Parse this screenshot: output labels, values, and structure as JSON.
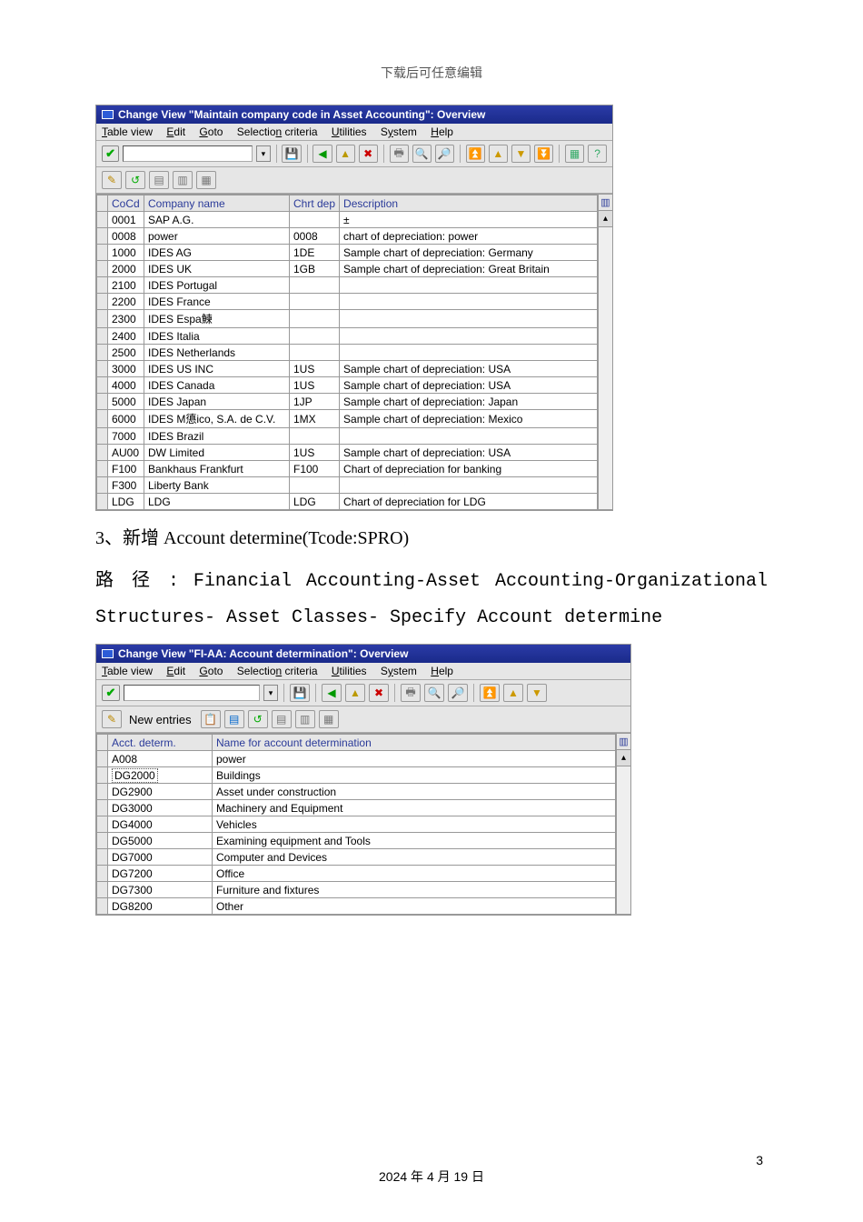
{
  "page_header": "下载后可任意编辑",
  "page_footer_date": "2024 年 4 月 19 日",
  "page_number": "3",
  "window1": {
    "title": "Change View \"Maintain company code in Asset Accounting\": Overview",
    "menu": [
      "Table view",
      "Edit",
      "Goto",
      "Selection criteria",
      "Utilities",
      "System",
      "Help"
    ],
    "columns": {
      "cocd": "CoCd",
      "cname": "Company name",
      "chrt": "Chrt dep",
      "desc": "Description"
    },
    "rows": [
      {
        "cocd": "0001",
        "cname": "SAP A.G.",
        "chrt": "",
        "desc": "",
        "extra": "±"
      },
      {
        "cocd": "0008",
        "cname": "power",
        "chrt": "0008",
        "desc": "chart of depreciation: power"
      },
      {
        "cocd": "1000",
        "cname": "IDES AG",
        "chrt": "1DE",
        "desc": "Sample chart of depreciation: Germany"
      },
      {
        "cocd": "2000",
        "cname": "IDES UK",
        "chrt": "1GB",
        "desc": "Sample chart of depreciation: Great Britain"
      },
      {
        "cocd": "2100",
        "cname": "IDES Portugal",
        "chrt": "",
        "desc": ""
      },
      {
        "cocd": "2200",
        "cname": "IDES France",
        "chrt": "",
        "desc": ""
      },
      {
        "cocd": "2300",
        "cname": "IDES Espa鰊",
        "chrt": "",
        "desc": ""
      },
      {
        "cocd": "2400",
        "cname": "IDES Italia",
        "chrt": "",
        "desc": ""
      },
      {
        "cocd": "2500",
        "cname": "IDES Netherlands",
        "chrt": "",
        "desc": ""
      },
      {
        "cocd": "3000",
        "cname": "IDES US INC",
        "chrt": "1US",
        "desc": "Sample chart of depreciation: USA"
      },
      {
        "cocd": "4000",
        "cname": "IDES Canada",
        "chrt": "1US",
        "desc": "Sample chart of depreciation: USA"
      },
      {
        "cocd": "5000",
        "cname": "IDES Japan",
        "chrt": "1JP",
        "desc": "Sample chart of depreciation: Japan"
      },
      {
        "cocd": "6000",
        "cname": "IDES M憄ico, S.A. de C.V.",
        "chrt": "1MX",
        "desc": "Sample chart of depreciation: Mexico"
      },
      {
        "cocd": "7000",
        "cname": "IDES Brazil",
        "chrt": "",
        "desc": ""
      },
      {
        "cocd": "AU00",
        "cname": "DW Limited",
        "chrt": "1US",
        "desc": "Sample chart of depreciation: USA"
      },
      {
        "cocd": "F100",
        "cname": "Bankhaus Frankfurt",
        "chrt": "F100",
        "desc": "Chart of depreciation for banking"
      },
      {
        "cocd": "F300",
        "cname": "Liberty Bank",
        "chrt": "",
        "desc": ""
      },
      {
        "cocd": "LDG",
        "cname": "LDG",
        "chrt": "LDG",
        "desc": "Chart of depreciation for LDG"
      }
    ]
  },
  "section3_heading": "3、新增 Account determine(Tcode:SPRO)",
  "section3_path": "路 径 : Financial Accounting-Asset Accounting-Organizational Structures- Asset Classes- Specify Account determine",
  "window2": {
    "title": "Change View \"FI-AA: Account determination\": Overview",
    "menu": [
      "Table view",
      "Edit",
      "Goto",
      "Selection criteria",
      "Utilities",
      "System",
      "Help"
    ],
    "new_entries": "New entries",
    "columns": {
      "acct": "Acct. determ.",
      "name": "Name for account determination"
    },
    "rows": [
      {
        "acct": "A008",
        "name": "power"
      },
      {
        "acct": "DG2000",
        "name": "Buildings"
      },
      {
        "acct": "DG2900",
        "name": "Asset under construction"
      },
      {
        "acct": "DG3000",
        "name": "Machinery and Equipment"
      },
      {
        "acct": "DG4000",
        "name": "Vehicles"
      },
      {
        "acct": "DG5000",
        "name": "Examining equipment and Tools"
      },
      {
        "acct": "DG7000",
        "name": "Computer and Devices"
      },
      {
        "acct": "DG7200",
        "name": "Office"
      },
      {
        "acct": "DG7300",
        "name": "Furniture and fixtures"
      },
      {
        "acct": "DG8200",
        "name": "Other"
      }
    ]
  }
}
